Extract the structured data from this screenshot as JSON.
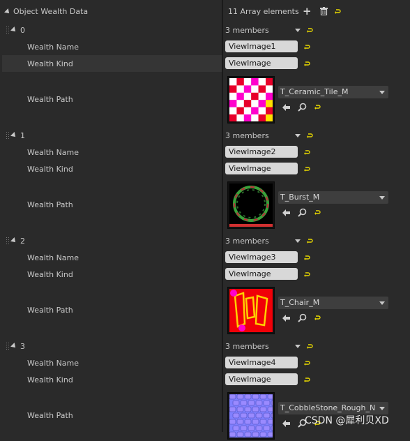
{
  "header": {
    "title": "Object Wealth Data",
    "count_label": "11 Array elements",
    "icons": [
      "add-icon",
      "trash-icon",
      "reset-icon"
    ]
  },
  "entries": [
    {
      "index": "0",
      "summary": "3 members",
      "labels": {
        "name": "Wealth Name",
        "kind": "Wealth Kind",
        "path": "Wealth Path"
      },
      "name_value": "ViewImage1",
      "kind_value": "ViewImage",
      "asset": "T_Ceramic_Tile_M"
    },
    {
      "index": "1",
      "summary": "3 members",
      "labels": {
        "name": "Wealth Name",
        "kind": "Wealth Kind",
        "path": "Wealth Path"
      },
      "name_value": "ViewImage2",
      "kind_value": "ViewImage",
      "asset": "T_Burst_M"
    },
    {
      "index": "2",
      "summary": "3 members",
      "labels": {
        "name": "Wealth Name",
        "kind": "Wealth Kind",
        "path": "Wealth Path"
      },
      "name_value": "ViewImage3",
      "kind_value": "ViewImage",
      "asset": "T_Chair_M"
    },
    {
      "index": "3",
      "summary": "3 members",
      "labels": {
        "name": "Wealth Name",
        "kind": "Wealth Kind",
        "path": "Wealth Path"
      },
      "name_value": "ViewImage4",
      "kind_value": "ViewImage",
      "asset": "T_CobbleStone_Rough_N"
    }
  ],
  "watermark": "CSDN @犀利贝XD",
  "colors": {
    "background": "#2a2a2a",
    "highlight_row": "#353535",
    "field": "#d8d8d8",
    "reset_yellow": "#e6d600"
  }
}
